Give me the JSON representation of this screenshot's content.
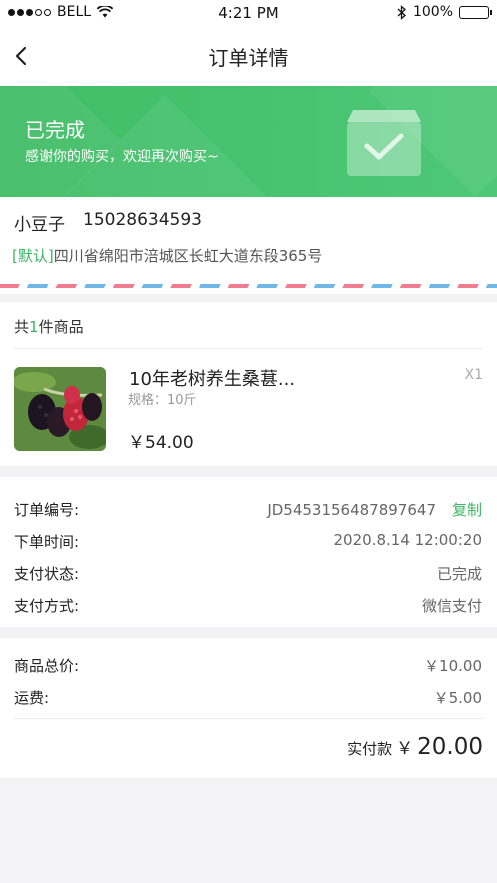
{
  "status_bar": {
    "carrier": "BELL",
    "time": "4:21 PM",
    "battery": "100%"
  },
  "nav": {
    "title": "订单详情"
  },
  "banner": {
    "status_title": "已完成",
    "subtitle": "感谢你的购买，欢迎再次购买~"
  },
  "address": {
    "name": "小豆子",
    "phone": "15028634593",
    "default_tag": "[默认]",
    "address_text": "四川省绵阳市涪城区长虹大道东段365号"
  },
  "goods": {
    "count_prefix": "共",
    "count": "1",
    "count_suffix": "件商品",
    "items": [
      {
        "name": "10年老树养生桑葚...",
        "spec": "规格：10斤",
        "qty": "X1",
        "price": "￥54.00"
      }
    ]
  },
  "order_info": {
    "order_no_label": "订单编号:",
    "order_no": "JD5453156487897647",
    "copy_label": "复制",
    "order_time_label": "下单时间:",
    "order_time": "2020.8.14  12:00:20",
    "pay_status_label": "支付状态:",
    "pay_status": "已完成",
    "pay_method_label": "支付方式:",
    "pay_method": "微信支付"
  },
  "price_summary": {
    "goods_total_label": "商品总价:",
    "goods_total": "￥10.00",
    "shipping_label": "运费:",
    "shipping": "￥5.00",
    "paid_label": "实付款",
    "paid_currency": "￥",
    "paid_value": "20.00"
  },
  "colors": {
    "brand_green": "#3cb563",
    "banner_green": "#4ec877"
  }
}
